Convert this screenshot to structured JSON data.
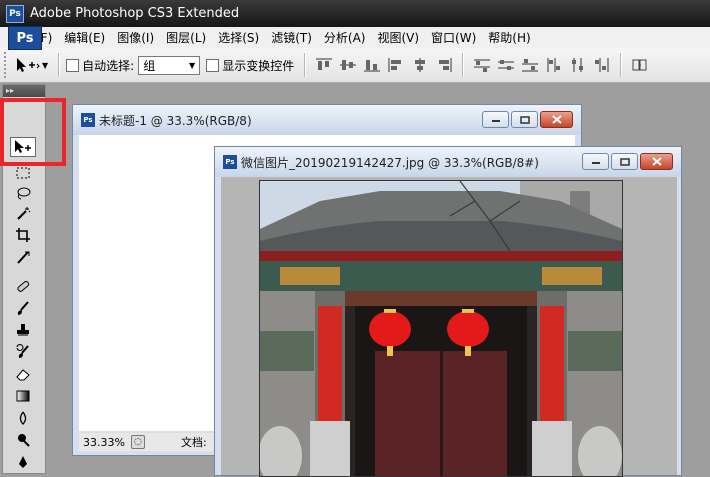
{
  "window": {
    "title": "Adobe Photoshop CS3 Extended",
    "badge": "Ps"
  },
  "menu": [
    "文件(F)",
    "编辑(E)",
    "图像(I)",
    "图层(L)",
    "选择(S)",
    "滤镜(T)",
    "分析(A)",
    "视图(V)",
    "窗口(W)",
    "帮助(H)"
  ],
  "options": {
    "auto_select_label": "自动选择:",
    "auto_select_value": "组",
    "show_transform_label": "显示变换控件"
  },
  "toolbox": {
    "logo": "Ps",
    "grip": "▸▸"
  },
  "doc1": {
    "title": "未标题-1 @ 33.3%(RGB/8)",
    "zoom": "33.33%",
    "doc_label": "文档:"
  },
  "doc2": {
    "title": "微信图片_20190219142427.jpg @ 33.3%(RGB/8#)"
  },
  "colors": {
    "highlight": "#e8262b",
    "ps_blue": "#1c4e9c"
  }
}
